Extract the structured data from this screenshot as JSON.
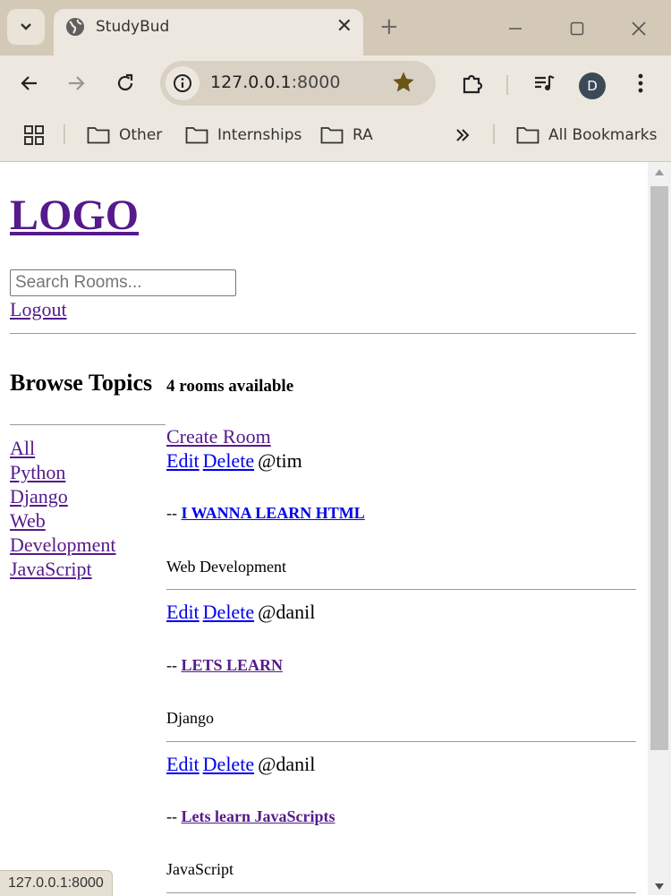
{
  "browser": {
    "tab_title": "StudyBud",
    "url_host": "127.0.0.1",
    "url_port": ":8000",
    "avatar_letter": "D",
    "bookmarks": [
      "Other",
      "Internships",
      "RA"
    ],
    "all_bookmarks": "All Bookmarks",
    "status_url": "127.0.0.1:8000"
  },
  "header": {
    "logo": "LOGO",
    "search_placeholder": "Search Rooms...",
    "logout": "Logout"
  },
  "sidebar": {
    "title": "Browse Topics",
    "topics": [
      "All",
      "Python",
      "Django",
      "Web",
      "Development",
      "JavaScript"
    ]
  },
  "main": {
    "count_text": "4 rooms available",
    "create_room": "Create Room",
    "edit_label": "Edit",
    "delete_label": "Delete",
    "dash": "--",
    "rooms": [
      {
        "host": "@tim",
        "name": "I WANNA LEARN HTML",
        "topic": "Web Development",
        "link_color": "#0000ee"
      },
      {
        "host": "@danil",
        "name": "LETS LEARN",
        "topic": "Django",
        "link_color": "#551a8b"
      },
      {
        "host": "@danil",
        "name": "Lets learn JavaScripts",
        "topic": "JavaScript",
        "link_color": "#551a8b"
      }
    ]
  },
  "colors": {
    "visited_link": "#551a8b",
    "unvisited_link": "#0000ee",
    "chrome_tabbar": "#d3c9b6",
    "chrome_toolbar": "#ede8df"
  }
}
